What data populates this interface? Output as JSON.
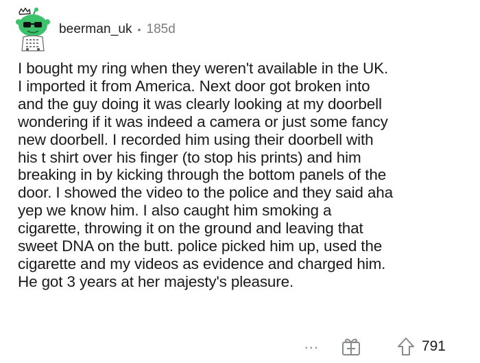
{
  "comment": {
    "author": "beerman_uk",
    "separator": "•",
    "age": "185d",
    "body_lines": [
      "I bought my ring when they weren't available in the UK.",
      "I imported it from America. Next door got broken into",
      "and the guy doing it was clearly looking at my doorbell",
      "wondering if it was indeed a camera or just some fancy",
      "new doorbell. I recorded him using their doorbell with",
      "his t shirt over his finger (to stop his prints) and him",
      "breaking in by kicking through the bottom panels of the",
      "door. I showed the video to the police and they said aha",
      "yep we know him. I also caught him smoking a",
      "cigarette, throwing it on the ground and leaving that",
      "sweet DNA on the butt. police picked him up, used the",
      "cigarette and my videos as evidence and charged him.",
      "He got 3 years at her majesty's pleasure."
    ],
    "actions": {
      "more_label": "...",
      "award_icon": "gift-award-icon",
      "upvote_icon": "upvote-arrow-icon",
      "score": "791"
    }
  },
  "colors": {
    "avatar_green": "#3cc26a",
    "meta_gray": "#7c7c7c",
    "text": "#1a1a1b",
    "icon_gray": "#878a8c"
  }
}
